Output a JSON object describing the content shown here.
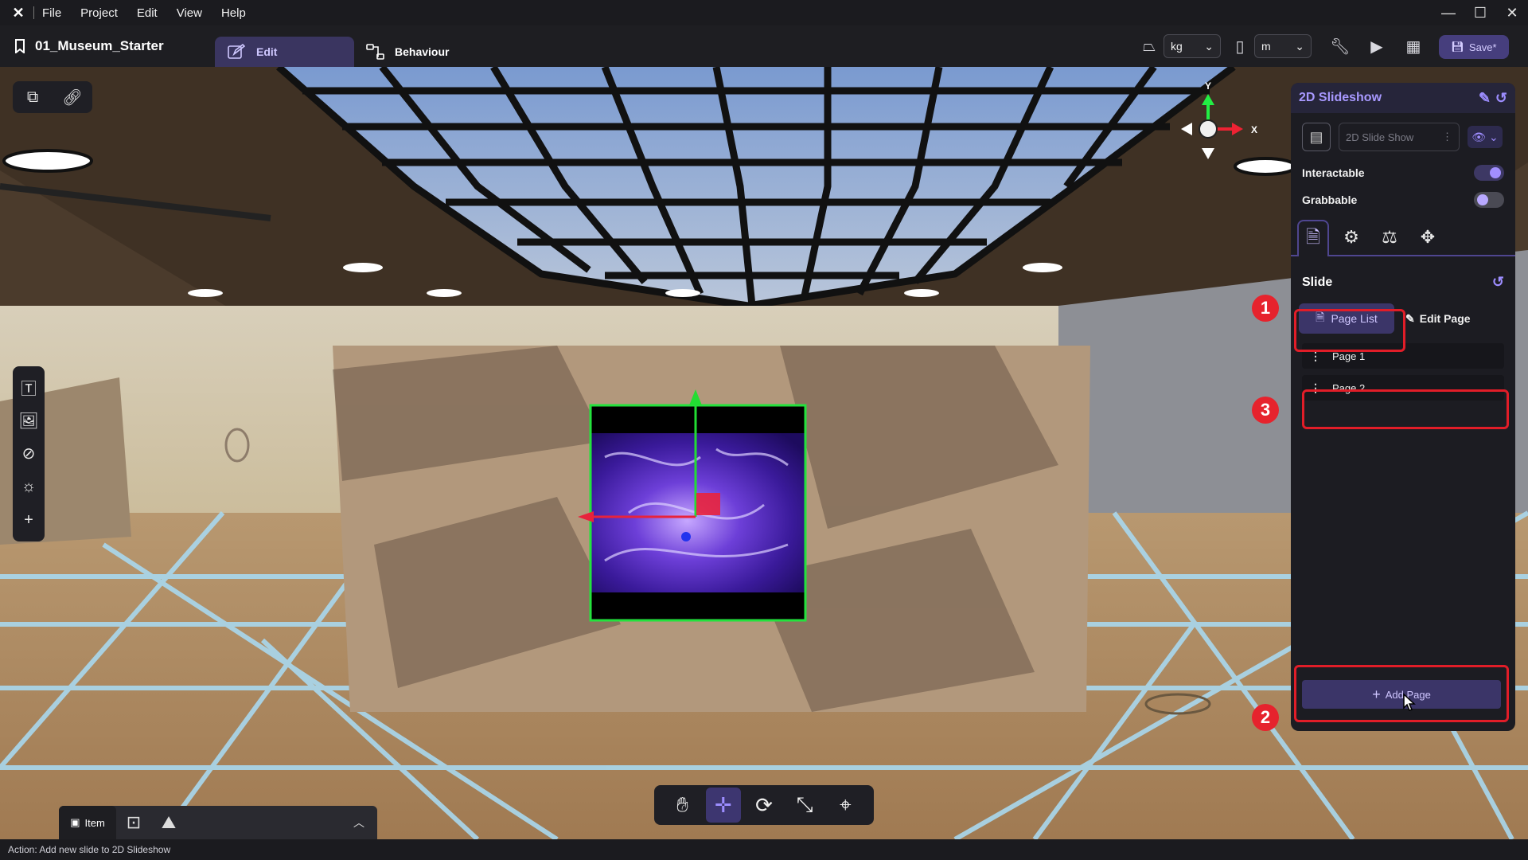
{
  "menubar": {
    "logo": "✕",
    "items": [
      "File",
      "Project",
      "Edit",
      "View",
      "Help"
    ],
    "window_controls": [
      "minimize-icon",
      "maximize-icon",
      "close-icon"
    ]
  },
  "toolbar": {
    "project_name": "01_Museum_Starter",
    "tabs": [
      {
        "label": "Edit",
        "icon": "edit-icon",
        "active": true
      },
      {
        "label": "Behaviour",
        "icon": "behaviour-icon",
        "active": false
      }
    ],
    "mass_unit": "kg",
    "length_unit": "m",
    "save_label": "Save*"
  },
  "viewport": {
    "gizmo_axes": {
      "y": "Y",
      "x": "X"
    },
    "transform_tools": [
      "hand-icon",
      "move-icon",
      "rotate-icon",
      "scale-icon",
      "transform-icon"
    ],
    "active_tool": "move-icon",
    "left_tools": [
      "text-icon",
      "image-icon",
      "slash-icon",
      "light-icon",
      "add-icon"
    ],
    "item_dock": {
      "item_label": "Item"
    }
  },
  "panel": {
    "title": "2D Slideshow",
    "object_name": "2D Slide Show",
    "interactable_label": "Interactable",
    "interactable_on": true,
    "grabbable_label": "Grabbable",
    "grabbable_on": false,
    "section_title": "Slide",
    "page_list_label": "Page List",
    "edit_page_label": "Edit Page",
    "pages": [
      "Page 1",
      "Page 2"
    ],
    "add_page_label": "Add Page"
  },
  "callouts": [
    "1",
    "2",
    "3"
  ],
  "status": "Action: Add new slide to 2D Slideshow",
  "colors": {
    "accent": "#a899ff",
    "highlight": "#e11d28",
    "panel_bg": "#1c1c22"
  }
}
